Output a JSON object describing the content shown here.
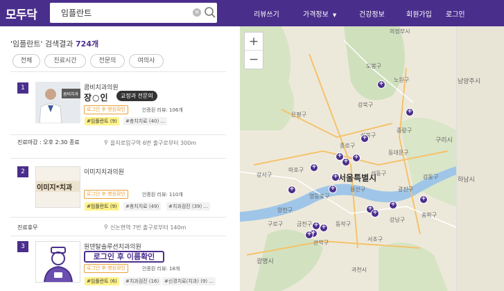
{
  "header": {
    "logo": "모두닥",
    "search_value": "임플란트",
    "nav": [
      "리뷰쓰기",
      "가격정보",
      "건강정보",
      "회원가입",
      "로그인"
    ]
  },
  "results": {
    "keyword": "'임플란트'",
    "label": "검색결과",
    "count": "724개",
    "filters": [
      "전체",
      "진료시간",
      "전문의",
      "여의사"
    ]
  },
  "clinics": [
    {
      "rank": "1",
      "name": "콤비치과의원",
      "doctor": "장○인",
      "tooltip": "교정과 전문의",
      "login_badge": "로그인 후 병원확인",
      "reviews": "인증된 리뷰: 106개",
      "tags": [
        "#임플란트 (9)",
        "#충치치료 (40) ..."
      ],
      "hours": "진료마감 : 오후 2:30 종료",
      "location": "을지로입구역 6번 출구로부터 300m",
      "thumb_text": "콤비치과"
    },
    {
      "rank": "2",
      "name": "이미지치과의원",
      "doctor": "",
      "login_badge": "로그인 후 병원확인",
      "reviews": "인증된 리뷰: 110개",
      "tags": [
        "#임플란트 (9)",
        "#충치치료 (49)",
        "#치과검진 (39) ..."
      ],
      "hours": "진료휴무",
      "location": "신논현역 7번 출구로부터 140m",
      "thumb_text": "이미지*치과"
    },
    {
      "rank": "3",
      "name": "원덴탈솔루션치과의원",
      "big_login": "로그인 후 이름확인",
      "login_badge": "로그인 후 병원확인",
      "reviews": "인증된 리뷰: 18개",
      "tags": [
        "#임플란트 (6)",
        "#치과검진 (16)",
        "#신경치료(치과) (9) ..."
      ]
    }
  ],
  "map": {
    "zoom_in": "+",
    "zoom_out": "−",
    "labels": [
      "의정부시",
      "구리시",
      "서울특별시",
      "중랑구",
      "강북구",
      "도봉구",
      "노원구",
      "은평구",
      "성북구",
      "동대문구",
      "종로구",
      "마포구",
      "광진구",
      "송파구",
      "강남구",
      "서초구",
      "동작구",
      "관악구",
      "광명시",
      "과천시",
      "강서구",
      "양천구",
      "영등포구",
      "하남시",
      "남양주시",
      "강동구",
      "용산구",
      "금천구",
      "구로구",
      "성동구"
    ]
  },
  "colors": {
    "brand": "#4a2e8c",
    "badge": "#e8a13a",
    "tag_highlight": "#fff38a"
  }
}
